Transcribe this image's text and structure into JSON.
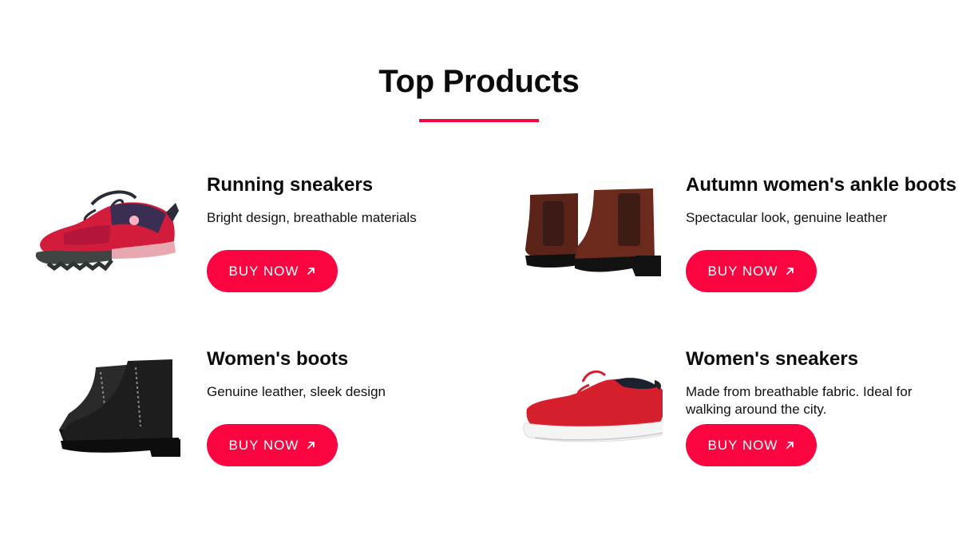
{
  "section": {
    "title": "Top Products",
    "accent_color": "#ee0b3f"
  },
  "products": [
    {
      "name": "Running sneakers",
      "description": "Bright design, breathable materials",
      "button_label": "BUY NOW",
      "button_icon": "arrow-up-right-icon",
      "image_icon": "running-sneaker-image"
    },
    {
      "name": "Autumn women's ankle boots",
      "description": "Spectacular look, genuine leather",
      "button_label": "BUY NOW",
      "button_icon": "arrow-up-right-icon",
      "image_icon": "ankle-boots-image"
    },
    {
      "name": "Women's boots",
      "description": "Genuine leather, sleek design",
      "button_label": "BUY NOW",
      "button_icon": "arrow-up-right-icon",
      "image_icon": "womens-boots-image"
    },
    {
      "name": "Women's sneakers",
      "description": "Made from breathable fabric. Ideal for walking around the city.",
      "button_label": "BUY NOW",
      "button_icon": "arrow-up-right-icon",
      "image_icon": "womens-sneakers-image"
    }
  ],
  "colors": {
    "button": "#fb0440",
    "button_text": "#ffffff"
  }
}
